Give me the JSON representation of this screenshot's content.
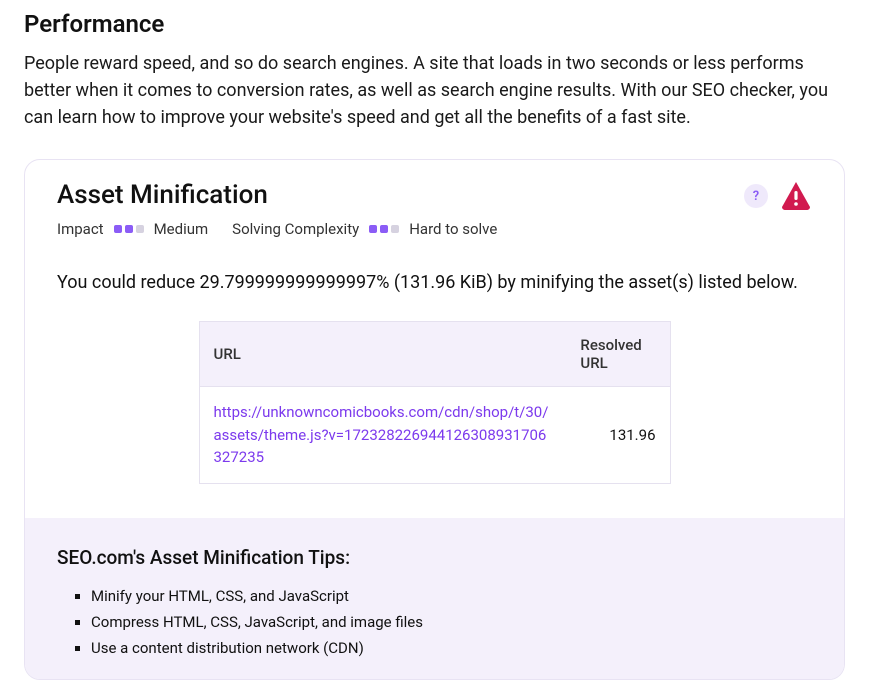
{
  "section": {
    "title": "Performance",
    "description": "People reward speed, and so do search engines. A site that loads in two seconds or less performs better when it comes to conversion rates, as well as search engine results. With our SEO checker, you can learn how to improve your website's speed and get all the benefits of a fast site."
  },
  "card": {
    "title": "Asset Minification",
    "impact_label": "Impact",
    "impact_value": "Medium",
    "impact_dots_filled": 2,
    "complexity_label": "Solving Complexity",
    "complexity_value": "Hard to solve",
    "complexity_dots_filled": 2,
    "help_glyph": "?",
    "summary": "You could reduce 29.799999999999997% (131.96 KiB) by minifying the asset(s) listed below.",
    "table": {
      "col_url": "URL",
      "col_resolved": "Resolved URL",
      "rows": [
        {
          "url": "https://unknowncomicbooks.com/cdn/shop/t/30/assets/theme.js?v=172328226944126308931706327235",
          "size": "131.96"
        }
      ]
    }
  },
  "tips": {
    "title": "SEO.com's Asset Minification Tips:",
    "items": [
      "Minify your HTML, CSS, and JavaScript",
      "Compress HTML, CSS, JavaScript, and image files",
      "Use a content distribution network (CDN)"
    ]
  }
}
